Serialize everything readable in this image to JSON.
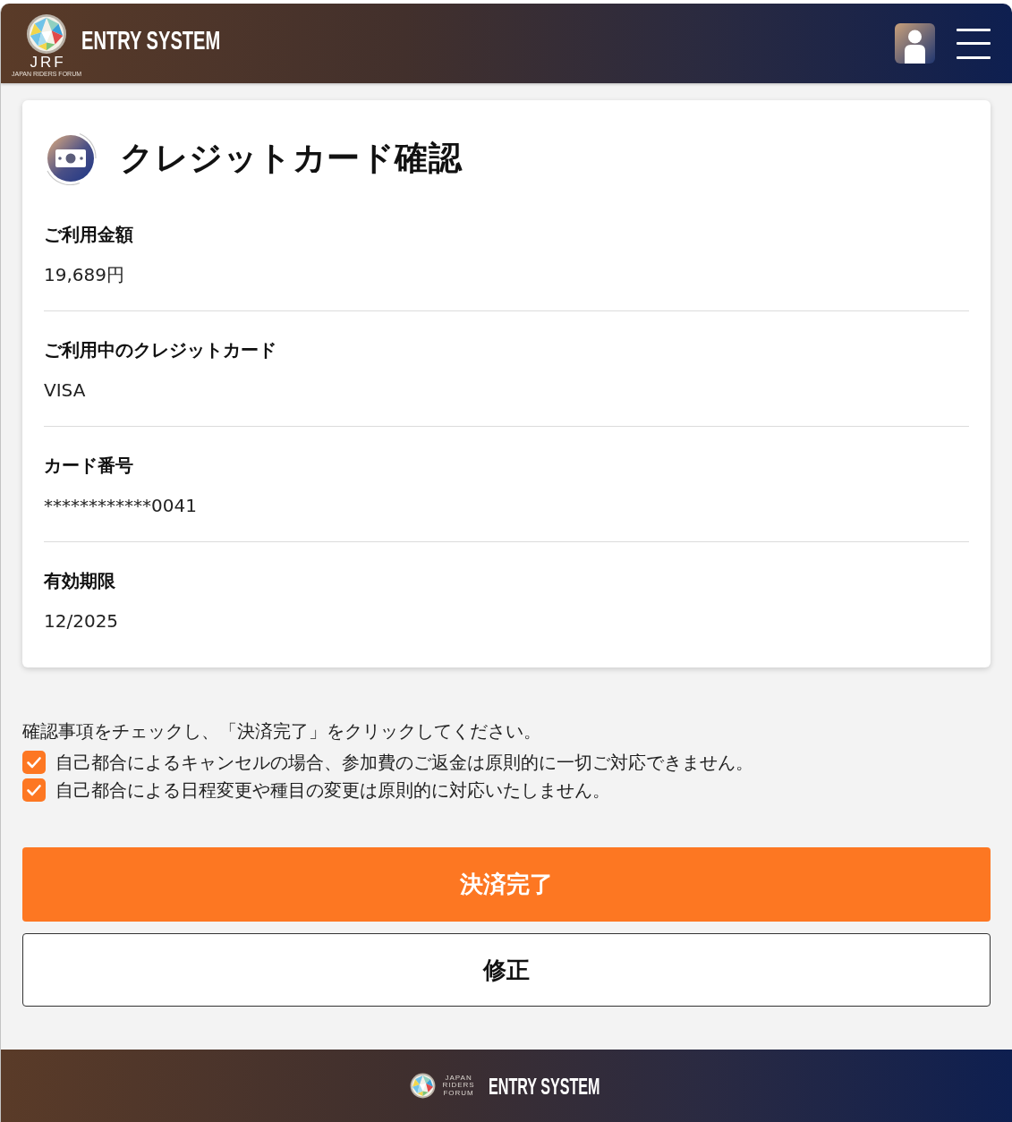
{
  "header": {
    "logo": {
      "letters": "JRF",
      "tagline": "JAPAN RIDERS FORUM"
    },
    "title": "ENTRY SYSTEM"
  },
  "card": {
    "title": "クレジットカード確認",
    "fields": [
      {
        "label": "ご利用金額",
        "value": "19,689円"
      },
      {
        "label": "ご利用中のクレジットカード",
        "value": "VISA"
      },
      {
        "label": "カード番号",
        "value": "************0041"
      },
      {
        "label": "有効期限",
        "value": "12/2025"
      }
    ]
  },
  "confirmation": {
    "instruction": "確認事項をチェックし、「決済完了」をクリックしてください。",
    "items": [
      {
        "label": "自己都合によるキャンセルの場合、参加費のご返金は原則的に一切ご対応できません。",
        "checked": true
      },
      {
        "label": "自己都合による日程変更や種目の変更は原則的に対応いたしません。",
        "checked": true
      }
    ]
  },
  "buttons": [
    {
      "label": "決済完了",
      "kind": "primary"
    },
    {
      "label": "修正",
      "kind": "secondary"
    }
  ],
  "footer": {
    "logo_text": "JAPAN RIDERS FORUM",
    "title": "ENTRY SYSTEM"
  }
}
